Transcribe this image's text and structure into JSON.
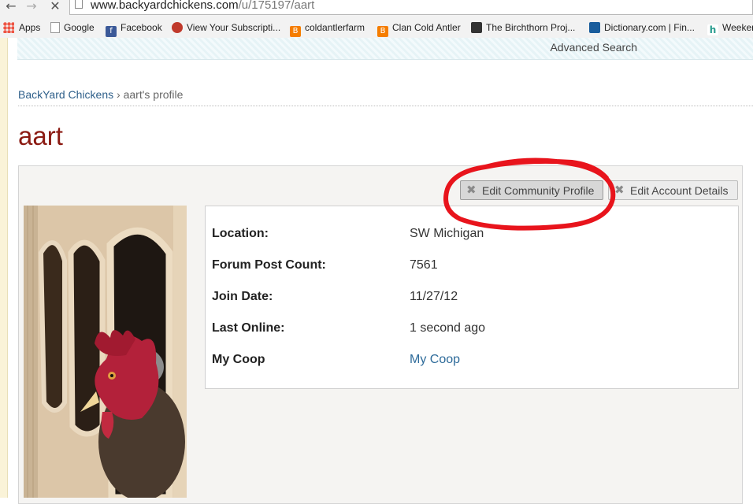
{
  "browser": {
    "back_glyph": "←",
    "forward_glyph": "→",
    "stop_glyph": "✕",
    "url_host": "www.backyardchickens.com",
    "url_path": "/u/175197/aart",
    "bookmarks": [
      {
        "label": "Apps",
        "icon": "apps-grid-icon"
      },
      {
        "label": "Google",
        "icon": "page-icon"
      },
      {
        "label": "Facebook",
        "icon": "facebook-icon",
        "color": "#3b5998"
      },
      {
        "label": "View Your Subscripti...",
        "icon": "rooster-icon",
        "color": "#c0392b"
      },
      {
        "label": "coldantlerfarm",
        "icon": "blogger-icon",
        "color": "#f57d00"
      },
      {
        "label": "Clan Cold Antler",
        "icon": "blogger-icon",
        "color": "#f57d00"
      },
      {
        "label": "The Birchthorn Proj...",
        "icon": "cube-icon",
        "color": "#333333"
      },
      {
        "label": "Dictionary.com | Fin...",
        "icon": "dictionary-icon",
        "color": "#1a5d9c"
      },
      {
        "label": "Weeken",
        "icon": "hm-icon",
        "color": "#2a9d8f"
      }
    ]
  },
  "header": {
    "advanced_search": "Advanced Search"
  },
  "breadcrumb": {
    "home": "BackYard Chickens",
    "separator": "›",
    "current": "aart's profile"
  },
  "profile": {
    "username": "aart",
    "buttons": {
      "edit_community": "Edit Community Profile",
      "edit_account": "Edit Account Details"
    },
    "fields": [
      {
        "label": "Location:",
        "value": "SW Michigan"
      },
      {
        "label": "Forum Post Count:",
        "value": "7561"
      },
      {
        "label": "Join Date:",
        "value": "11/27/12"
      },
      {
        "label": "Last Online:",
        "value": "1 second ago"
      },
      {
        "label": "My Coop",
        "value": "My Coop"
      }
    ]
  },
  "colors": {
    "title": "#8b1a12",
    "link": "#2e5f8a",
    "highlight_circle": "#e8141c"
  }
}
